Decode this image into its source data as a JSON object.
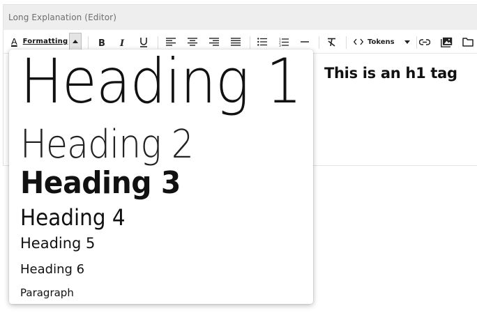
{
  "editor": {
    "label": "Long Explanation (Editor)",
    "content_h1": "This is an h1 tag"
  },
  "toolbar": {
    "format_icon": "A",
    "format_label": "Formatting",
    "tokens_label": "Tokens",
    "icons": [
      "bold-icon",
      "italic-icon",
      "underline-icon",
      "align-left-icon",
      "align-center-icon",
      "align-right-icon",
      "align-justify-icon",
      "bullet-list-icon",
      "numbered-list-icon",
      "horizontal-rule-icon",
      "clear-format-icon",
      "code-icon",
      "link-icon",
      "image-icon",
      "folder-icon"
    ]
  },
  "format_menu": {
    "options": [
      "Heading 1",
      "Heading 2",
      "Heading 3",
      "Heading 4",
      "Heading 5",
      "Heading 6",
      "Paragraph"
    ]
  }
}
